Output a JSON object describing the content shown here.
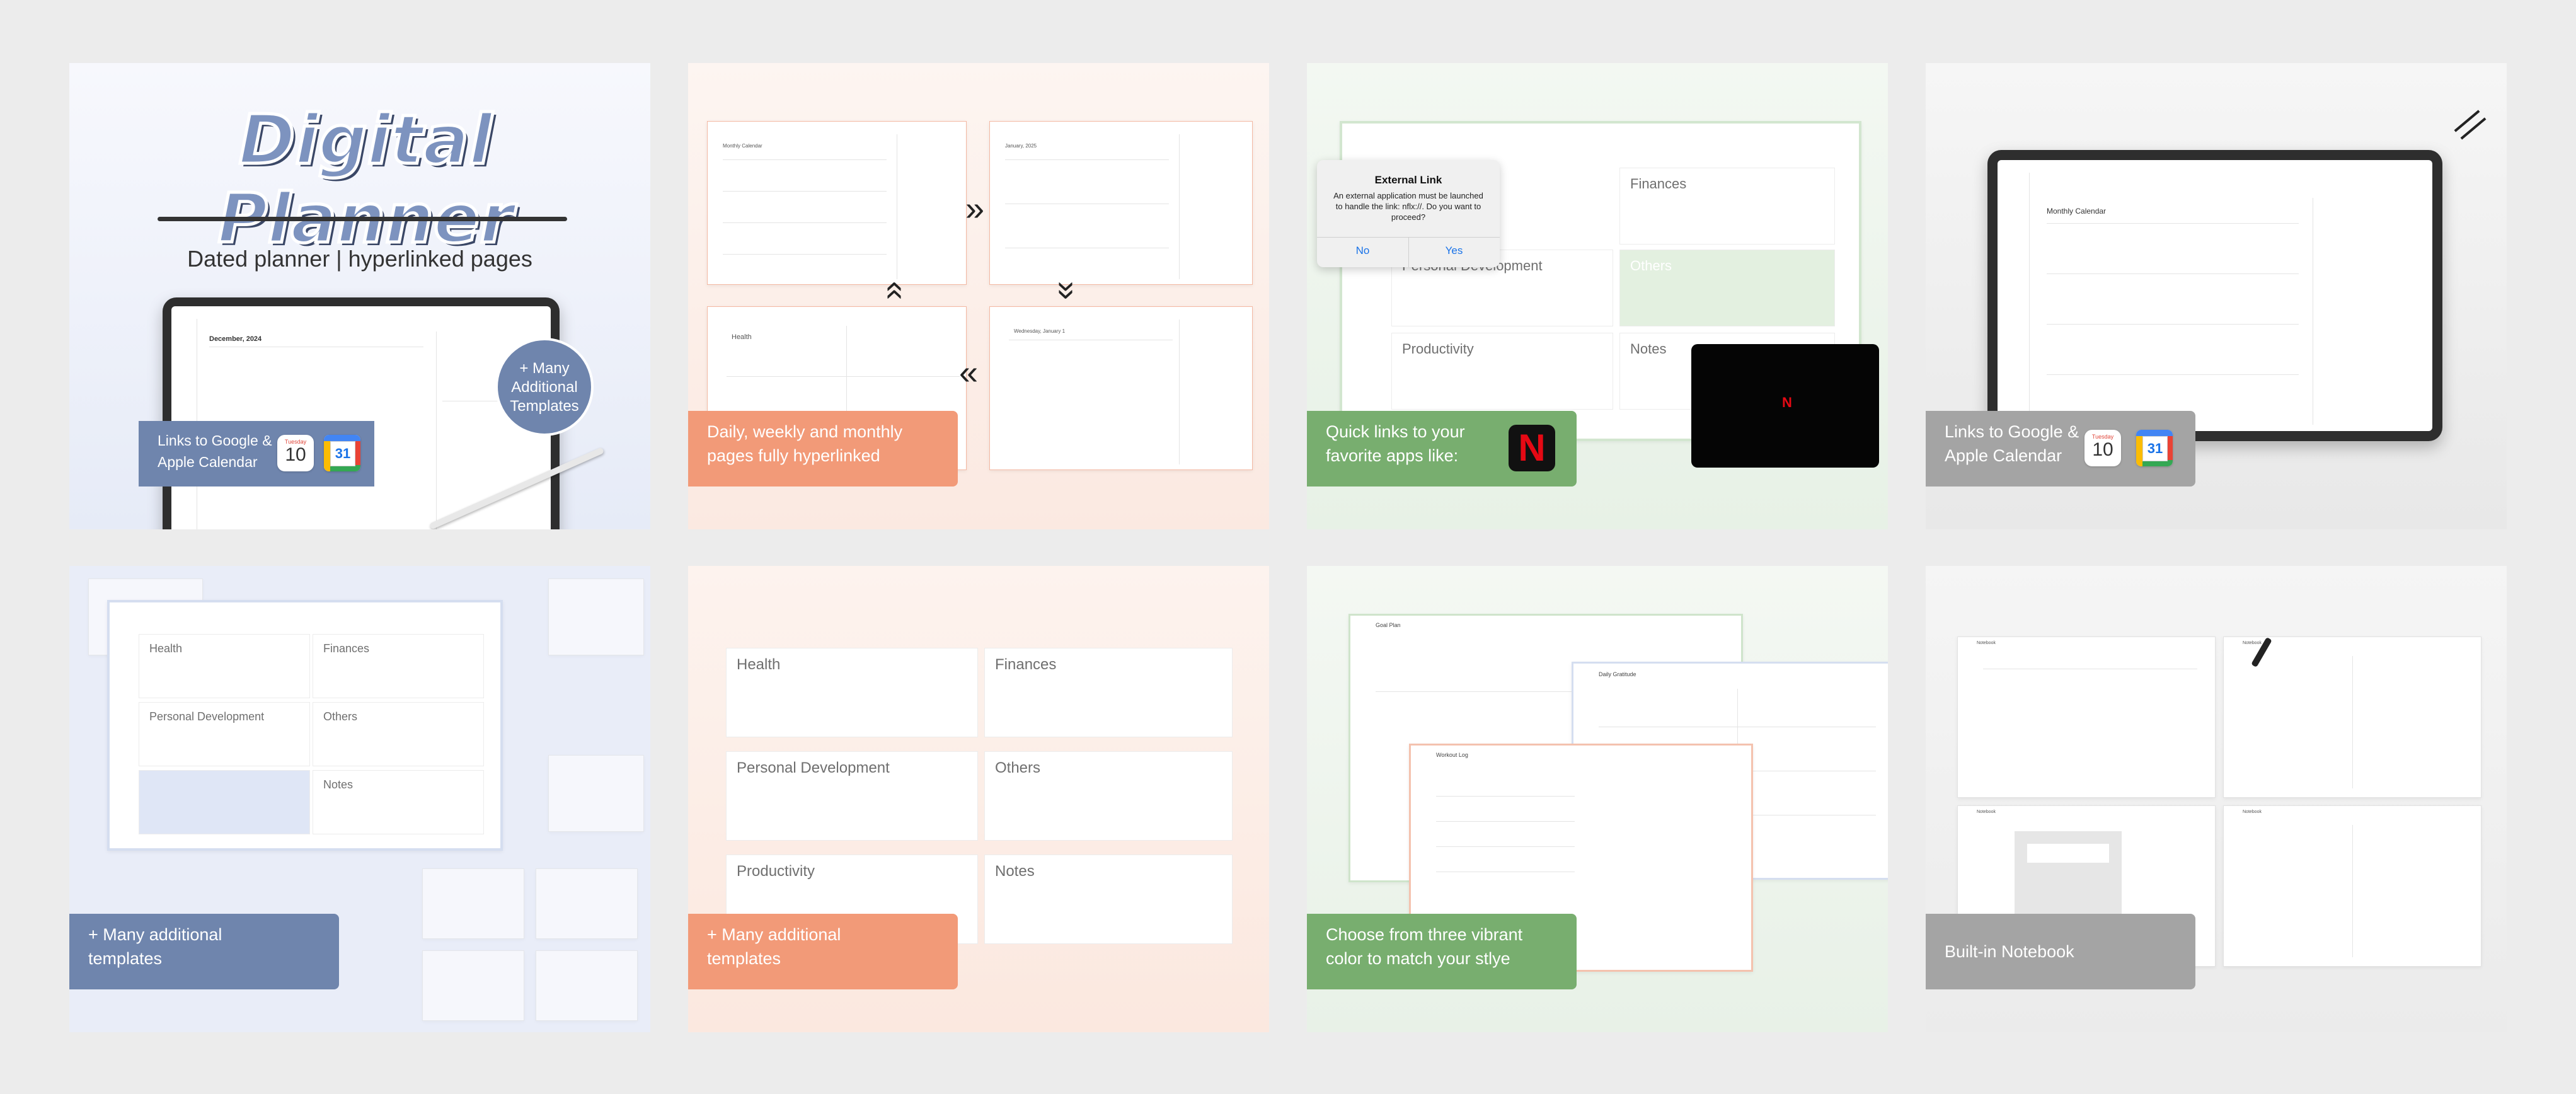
{
  "tiles": {
    "t1": {
      "title": "Digital Planner",
      "subtitle": "Dated planner | hyperlinked pages",
      "screen_heading": "December, 2024",
      "bubble": "+ Many Additional Templates",
      "banner": "Links to Google & Apple Calendar",
      "apple_month": "Tuesday",
      "apple_day": "10",
      "google_day": "31"
    },
    "t2": {
      "banner": "Daily, weekly and monthly pages fully hyperlinked",
      "page_titles": [
        "Monthly Calendar",
        "January, 2025",
        "Health",
        "Wednesday, January 1"
      ]
    },
    "t3": {
      "dialog_title": "External Link",
      "dialog_body": "An external application must be launched to handle the link: nflx://. Do you want to proceed?",
      "btn_no": "No",
      "btn_yes": "Yes",
      "cat_finances": "Finances",
      "cat_personal": "Personal Development",
      "cat_others": "Others",
      "cat_productivity": "Productivity",
      "cat_notes": "Notes",
      "banner": "Quick links to your favorite apps like:",
      "netflix_letter": "N"
    },
    "t4": {
      "screen_heading": "Monthly Calendar",
      "banner": "Links to Google & Apple Calendar",
      "apple_month": "Tuesday",
      "apple_day": "10",
      "google_day": "31"
    },
    "t5": {
      "cats": [
        "Health",
        "Finances",
        "Personal Development",
        "Others",
        "Notes"
      ],
      "banner": "+ Many additional templates"
    },
    "t6": {
      "cats": [
        "Health",
        "Finances",
        "Personal Development",
        "Others",
        "Productivity",
        "Notes"
      ],
      "banner": "+ Many additional templates"
    },
    "t7": {
      "page_goal": "Goal Plan",
      "page_daily": "Daily Gratitude",
      "page_workout": "Workout Log",
      "banner": "Choose from three vibrant color to match your stlye"
    },
    "t8": {
      "nb1": "Notebook",
      "nb2": "Notebook",
      "nb3": "Notebook",
      "nb4": "Notebook",
      "banner": "Built-in Notebook"
    }
  },
  "colors": {
    "blue": "#6f85ad",
    "orange": "#f29a78",
    "green": "#78ae6f",
    "grey": "#a4a4a4",
    "netflix_red": "#e50914"
  }
}
